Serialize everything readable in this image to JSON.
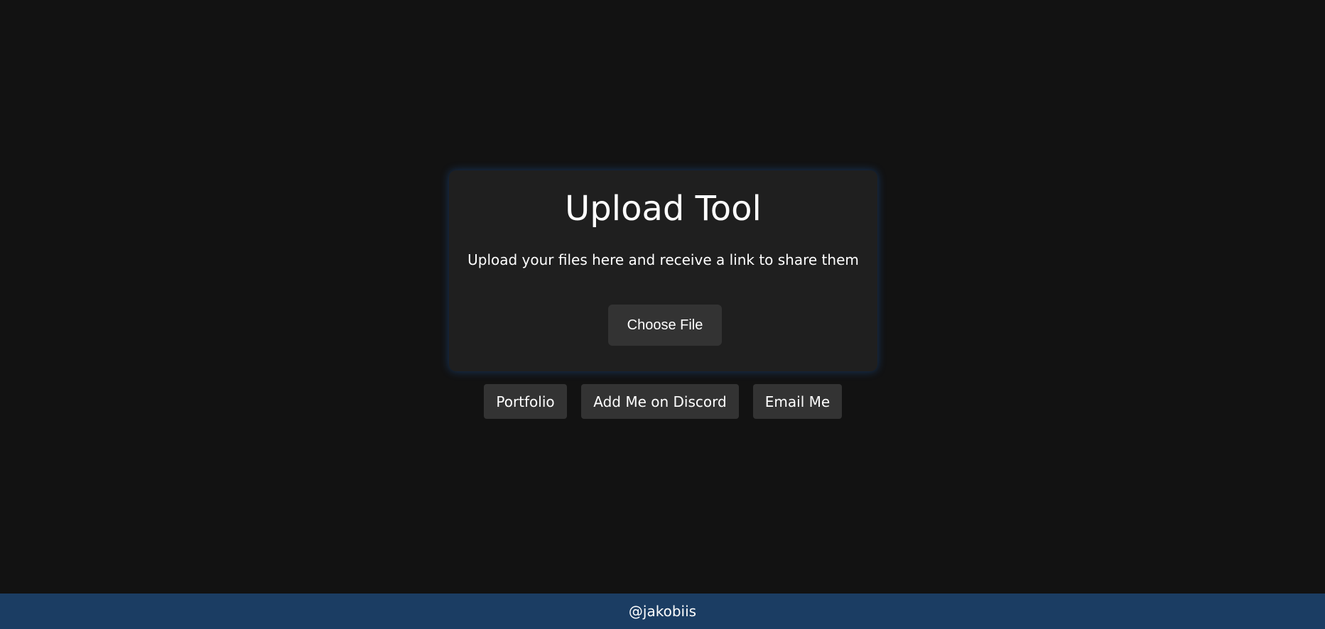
{
  "card": {
    "title": "Upload Tool",
    "subtitle": "Upload your files here and receive a link to share them",
    "choose_file_label": "Choose File"
  },
  "links": {
    "portfolio_label": "Portfolio",
    "discord_label": "Add Me on Discord",
    "email_label": "Email Me"
  },
  "footer": {
    "handle": "@jakobiis"
  },
  "colors": {
    "background": "#121212",
    "card": "#1f1f1f",
    "button": "#333333",
    "footer": "#1b3d63",
    "glow": "#1e64be"
  }
}
